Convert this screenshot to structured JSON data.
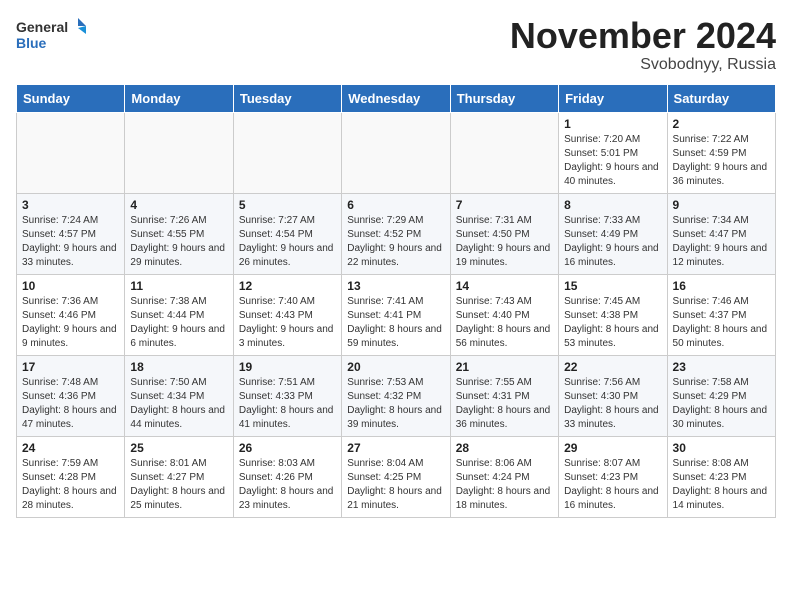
{
  "header": {
    "logo_general": "General",
    "logo_blue": "Blue",
    "month_title": "November 2024",
    "subtitle": "Svobodnyy, Russia"
  },
  "days_of_week": [
    "Sunday",
    "Monday",
    "Tuesday",
    "Wednesday",
    "Thursday",
    "Friday",
    "Saturday"
  ],
  "weeks": [
    [
      {
        "day": "",
        "info": ""
      },
      {
        "day": "",
        "info": ""
      },
      {
        "day": "",
        "info": ""
      },
      {
        "day": "",
        "info": ""
      },
      {
        "day": "",
        "info": ""
      },
      {
        "day": "1",
        "info": "Sunrise: 7:20 AM\nSunset: 5:01 PM\nDaylight: 9 hours and 40 minutes."
      },
      {
        "day": "2",
        "info": "Sunrise: 7:22 AM\nSunset: 4:59 PM\nDaylight: 9 hours and 36 minutes."
      }
    ],
    [
      {
        "day": "3",
        "info": "Sunrise: 7:24 AM\nSunset: 4:57 PM\nDaylight: 9 hours and 33 minutes."
      },
      {
        "day": "4",
        "info": "Sunrise: 7:26 AM\nSunset: 4:55 PM\nDaylight: 9 hours and 29 minutes."
      },
      {
        "day": "5",
        "info": "Sunrise: 7:27 AM\nSunset: 4:54 PM\nDaylight: 9 hours and 26 minutes."
      },
      {
        "day": "6",
        "info": "Sunrise: 7:29 AM\nSunset: 4:52 PM\nDaylight: 9 hours and 22 minutes."
      },
      {
        "day": "7",
        "info": "Sunrise: 7:31 AM\nSunset: 4:50 PM\nDaylight: 9 hours and 19 minutes."
      },
      {
        "day": "8",
        "info": "Sunrise: 7:33 AM\nSunset: 4:49 PM\nDaylight: 9 hours and 16 minutes."
      },
      {
        "day": "9",
        "info": "Sunrise: 7:34 AM\nSunset: 4:47 PM\nDaylight: 9 hours and 12 minutes."
      }
    ],
    [
      {
        "day": "10",
        "info": "Sunrise: 7:36 AM\nSunset: 4:46 PM\nDaylight: 9 hours and 9 minutes."
      },
      {
        "day": "11",
        "info": "Sunrise: 7:38 AM\nSunset: 4:44 PM\nDaylight: 9 hours and 6 minutes."
      },
      {
        "day": "12",
        "info": "Sunrise: 7:40 AM\nSunset: 4:43 PM\nDaylight: 9 hours and 3 minutes."
      },
      {
        "day": "13",
        "info": "Sunrise: 7:41 AM\nSunset: 4:41 PM\nDaylight: 8 hours and 59 minutes."
      },
      {
        "day": "14",
        "info": "Sunrise: 7:43 AM\nSunset: 4:40 PM\nDaylight: 8 hours and 56 minutes."
      },
      {
        "day": "15",
        "info": "Sunrise: 7:45 AM\nSunset: 4:38 PM\nDaylight: 8 hours and 53 minutes."
      },
      {
        "day": "16",
        "info": "Sunrise: 7:46 AM\nSunset: 4:37 PM\nDaylight: 8 hours and 50 minutes."
      }
    ],
    [
      {
        "day": "17",
        "info": "Sunrise: 7:48 AM\nSunset: 4:36 PM\nDaylight: 8 hours and 47 minutes."
      },
      {
        "day": "18",
        "info": "Sunrise: 7:50 AM\nSunset: 4:34 PM\nDaylight: 8 hours and 44 minutes."
      },
      {
        "day": "19",
        "info": "Sunrise: 7:51 AM\nSunset: 4:33 PM\nDaylight: 8 hours and 41 minutes."
      },
      {
        "day": "20",
        "info": "Sunrise: 7:53 AM\nSunset: 4:32 PM\nDaylight: 8 hours and 39 minutes."
      },
      {
        "day": "21",
        "info": "Sunrise: 7:55 AM\nSunset: 4:31 PM\nDaylight: 8 hours and 36 minutes."
      },
      {
        "day": "22",
        "info": "Sunrise: 7:56 AM\nSunset: 4:30 PM\nDaylight: 8 hours and 33 minutes."
      },
      {
        "day": "23",
        "info": "Sunrise: 7:58 AM\nSunset: 4:29 PM\nDaylight: 8 hours and 30 minutes."
      }
    ],
    [
      {
        "day": "24",
        "info": "Sunrise: 7:59 AM\nSunset: 4:28 PM\nDaylight: 8 hours and 28 minutes."
      },
      {
        "day": "25",
        "info": "Sunrise: 8:01 AM\nSunset: 4:27 PM\nDaylight: 8 hours and 25 minutes."
      },
      {
        "day": "26",
        "info": "Sunrise: 8:03 AM\nSunset: 4:26 PM\nDaylight: 8 hours and 23 minutes."
      },
      {
        "day": "27",
        "info": "Sunrise: 8:04 AM\nSunset: 4:25 PM\nDaylight: 8 hours and 21 minutes."
      },
      {
        "day": "28",
        "info": "Sunrise: 8:06 AM\nSunset: 4:24 PM\nDaylight: 8 hours and 18 minutes."
      },
      {
        "day": "29",
        "info": "Sunrise: 8:07 AM\nSunset: 4:23 PM\nDaylight: 8 hours and 16 minutes."
      },
      {
        "day": "30",
        "info": "Sunrise: 8:08 AM\nSunset: 4:23 PM\nDaylight: 8 hours and 14 minutes."
      }
    ]
  ]
}
